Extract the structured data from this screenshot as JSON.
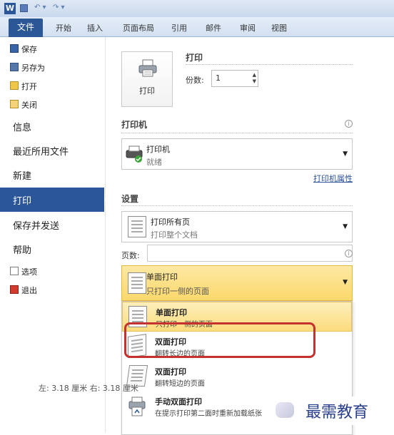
{
  "titlebar": {
    "logo": "W"
  },
  "tabs": [
    "文件",
    "开始",
    "插入",
    "页面布局",
    "引用",
    "邮件",
    "审阅",
    "视图"
  ],
  "leftnav": {
    "save": "保存",
    "save_as": "另存为",
    "open": "打开",
    "close": "关闭",
    "info": "信息",
    "recent": "最近所用文件",
    "new": "新建",
    "print": "打印",
    "save_send": "保存并发送",
    "help": "帮助",
    "options": "选项",
    "exit": "退出"
  },
  "print": {
    "button_label": "打印",
    "title": "打印",
    "copies_label": "份数:",
    "copies_value": "1"
  },
  "printer": {
    "section_title": "打印机",
    "name": "打印机",
    "status": "就绪",
    "properties_link": "打印机属性"
  },
  "settings": {
    "section_title": "设置",
    "range_title": "打印所有页",
    "range_desc": "打印整个文档",
    "pages_label": "页数:",
    "pages_value": "",
    "selected_title": "单面打印",
    "selected_desc": "只打印一侧的页面"
  },
  "menu_items": [
    {
      "title": "单面打印",
      "desc": "只打印一侧的页面",
      "icon": "single-sided-icon"
    },
    {
      "title": "双面打印",
      "desc": "翻转长边的页面",
      "icon": "duplex-long-edge-icon"
    },
    {
      "title": "双面打印",
      "desc": "翻转短边的页面",
      "icon": "duplex-short-edge-icon"
    },
    {
      "title": "手动双面打印",
      "desc": "在提示打印第二面时重新加载纸张",
      "icon": "manual-duplex-icon"
    }
  ],
  "margins_text": "左: 3.18 厘米    右: 3.18 厘米",
  "watermark": "最需教育",
  "colors": {
    "accent": "#2b579a",
    "highlight": "#fbd86b",
    "annotation": "#c4312e"
  }
}
